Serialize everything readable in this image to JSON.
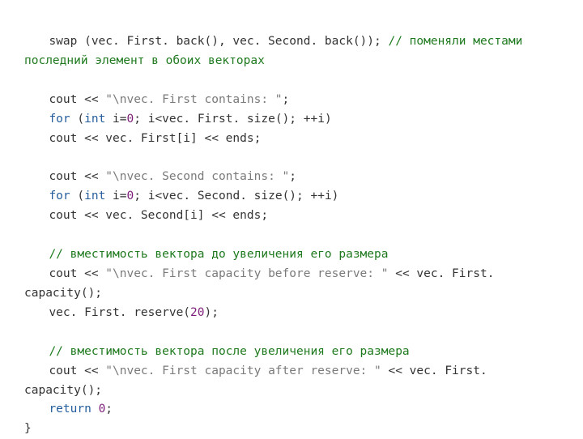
{
  "c": {
    "swap": "swap (vec. First. back(), vec. Second. back()); ",
    "swap_cm": "// поменяли местами последний элемент в обоих векторах",
    "l1a": "cout << ",
    "l1s": "\"\\nvec. First contains: \"",
    "l1b": "; ",
    "l2a": "for",
    "l2b": " (",
    "l2c": "int",
    "l2d": " i=",
    "l2n0": "0",
    "l2e": "; i<vec. First. size(); ++i)",
    "l3": "cout << vec. First[i] << ends; ",
    "l4a": "cout << ",
    "l4s": "\"\\nvec. Second contains: \"",
    "l4b": "; ",
    "l5a": "for",
    "l5b": " (",
    "l5c": "int",
    "l5d": " i=",
    "l5n0": "0",
    "l5e": "; i<vec. Second. size(); ++i)",
    "l6": "cout << vec. Second[i] << ends; ",
    "cm2": "// вместимость вектора до увеличения его размера",
    "l7a": "cout << ",
    "l7s": "\"\\nvec. First capacity before reserve: \"",
    "l7b": " << vec. First. capacity();",
    "l8a": "vec. First. reserve(",
    "l8n": "20",
    "l8b": ");",
    "cm3": "// вместимость вектора после увеличения его размера",
    "l9a": "cout << ",
    "l9s": "\"\\nvec. First capacity after reserve: \"",
    "l9b": " << vec. First. capacity();",
    "l10a": "return",
    "l10b": " ",
    "l10n": "0",
    "l10c": ";",
    "brace": "}"
  }
}
